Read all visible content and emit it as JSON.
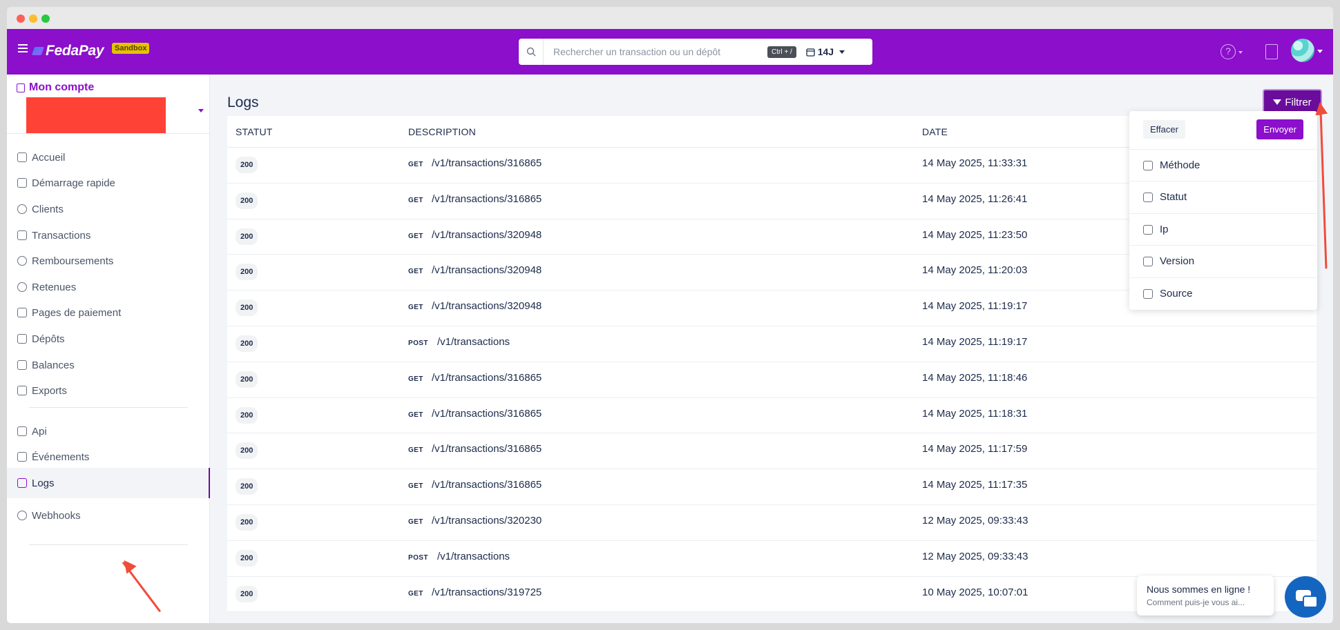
{
  "header": {
    "brand": "FedaPay",
    "env_badge": "Sandbox",
    "search_placeholder": "Rechercher un transaction ou un dépôt",
    "shortcut": "Ctrl + /",
    "period": "14J"
  },
  "account": {
    "title": "Mon compte"
  },
  "sidebar": {
    "items": [
      {
        "label": "Accueil",
        "icon": "home-icon"
      },
      {
        "label": "Démarrage rapide",
        "icon": "flag-icon"
      },
      {
        "label": "Clients",
        "icon": "user-circle-icon"
      },
      {
        "label": "Transactions",
        "icon": "cash-icon"
      },
      {
        "label": "Remboursements",
        "icon": "refund-icon"
      },
      {
        "label": "Retenues",
        "icon": "alert-circle-icon"
      },
      {
        "label": "Pages de paiement",
        "icon": "document-icon"
      },
      {
        "label": "Dépôts",
        "icon": "external-link-icon"
      },
      {
        "label": "Balances",
        "icon": "scale-icon"
      },
      {
        "label": "Exports",
        "icon": "download-icon"
      },
      {
        "label": "Api",
        "icon": "terminal-icon"
      },
      {
        "label": "Événements",
        "icon": "rss-icon"
      },
      {
        "label": "Logs",
        "icon": "file-icon",
        "active": true
      },
      {
        "label": "Webhooks",
        "icon": "link-icon"
      }
    ]
  },
  "page": {
    "title": "Logs",
    "filter_label": "Filtrer"
  },
  "table": {
    "columns": [
      "STATUT",
      "DESCRIPTION",
      "DATE"
    ],
    "rows": [
      {
        "status": "200",
        "method": "GET",
        "path": "/v1/transactions/316865",
        "date": "14 May 2025, 11:33:31"
      },
      {
        "status": "200",
        "method": "GET",
        "path": "/v1/transactions/316865",
        "date": "14 May 2025, 11:26:41"
      },
      {
        "status": "200",
        "method": "GET",
        "path": "/v1/transactions/320948",
        "date": "14 May 2025, 11:23:50"
      },
      {
        "status": "200",
        "method": "GET",
        "path": "/v1/transactions/320948",
        "date": "14 May 2025, 11:20:03"
      },
      {
        "status": "200",
        "method": "GET",
        "path": "/v1/transactions/320948",
        "date": "14 May 2025, 11:19:17"
      },
      {
        "status": "200",
        "method": "POST",
        "path": "/v1/transactions",
        "date": "14 May 2025, 11:19:17"
      },
      {
        "status": "200",
        "method": "GET",
        "path": "/v1/transactions/316865",
        "date": "14 May 2025, 11:18:46"
      },
      {
        "status": "200",
        "method": "GET",
        "path": "/v1/transactions/316865",
        "date": "14 May 2025, 11:18:31"
      },
      {
        "status": "200",
        "method": "GET",
        "path": "/v1/transactions/316865",
        "date": "14 May 2025, 11:17:59"
      },
      {
        "status": "200",
        "method": "GET",
        "path": "/v1/transactions/316865",
        "date": "14 May 2025, 11:17:35"
      },
      {
        "status": "200",
        "method": "GET",
        "path": "/v1/transactions/320230",
        "date": "12 May 2025, 09:33:43"
      },
      {
        "status": "200",
        "method": "POST",
        "path": "/v1/transactions",
        "date": "12 May 2025, 09:33:43"
      },
      {
        "status": "200",
        "method": "GET",
        "path": "/v1/transactions/319725",
        "date": "10 May 2025, 10:07:01"
      }
    ]
  },
  "filter_menu": {
    "clear_label": "Effacer",
    "send_label": "Envoyer",
    "options": [
      "Méthode",
      "Statut",
      "Ip",
      "Version",
      "Source"
    ]
  },
  "chat": {
    "title": "Nous sommes en ligne !",
    "subtitle": "Comment puis-je vous ai..."
  },
  "colors": {
    "brand": "#8b0fcb",
    "brand_dark": "#6a0d9c",
    "annotation": "#f04c3a"
  }
}
